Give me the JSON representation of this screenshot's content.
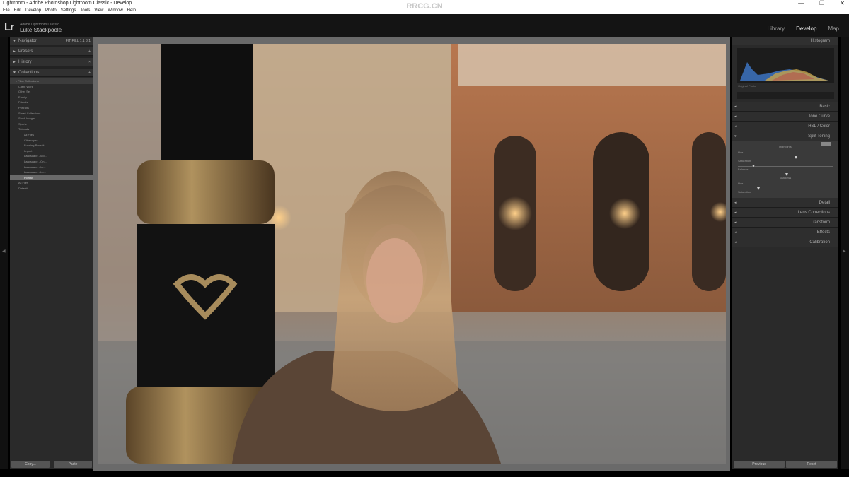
{
  "window": {
    "title": "Lightroom - Adobe Photoshop Lightroom Classic - Develop",
    "controls": [
      "—",
      "❐",
      "✕"
    ]
  },
  "watermark": "RRCG.CN",
  "menu": [
    "File",
    "Edit",
    "Develop",
    "Photo",
    "Settings",
    "Tools",
    "View",
    "Window",
    "Help"
  ],
  "identity": {
    "logo": "Lr",
    "sub": "Adobe Lightroom Classic",
    "name": "Luke Stackpoole"
  },
  "modules": [
    "Library",
    "Develop",
    "Map"
  ],
  "left_panel": {
    "navigator": {
      "label": "Navigator",
      "zoom": "FIT FILL 1:1 3:1"
    },
    "presets": "Presets",
    "history": "History",
    "collections": "Collections",
    "filter": "Filter Collections",
    "tree": [
      {
        "label": "Client Work",
        "count": "",
        "indent": 1
      },
      {
        "label": "Other Set",
        "count": "",
        "indent": 1
      },
      {
        "label": "Family",
        "count": "",
        "indent": 1
      },
      {
        "label": "Friends",
        "count": "",
        "indent": 1
      },
      {
        "label": "Portraits",
        "count": "",
        "indent": 1
      },
      {
        "label": "Smart Collections",
        "count": "",
        "indent": 1
      },
      {
        "label": "Stock Images",
        "count": "",
        "indent": 1
      },
      {
        "label": "Sports",
        "count": "",
        "indent": 1
      },
      {
        "label": "Tutorials",
        "count": "",
        "indent": 1
      },
      {
        "label": "All Files",
        "count": "",
        "indent": 2
      },
      {
        "label": "Cityscapes",
        "count": "",
        "indent": 2
      },
      {
        "label": "Evening Portrait",
        "count": "",
        "indent": 2
      },
      {
        "label": "Import",
        "count": "",
        "indent": 2
      },
      {
        "label": "Landscape - Mo...",
        "count": "",
        "indent": 2
      },
      {
        "label": "Landscape - On...",
        "count": "",
        "indent": 2
      },
      {
        "label": "Landscape - Ur...",
        "count": "",
        "indent": 2
      },
      {
        "label": "Landscape - Lo...",
        "count": "",
        "indent": 2
      },
      {
        "label": "Portrait",
        "count": "",
        "indent": 2,
        "selected": true
      },
      {
        "label": "All Files",
        "count": "",
        "indent": 1
      },
      {
        "label": "Default",
        "count": "",
        "indent": 1
      }
    ],
    "buttons": {
      "import": "Copy...",
      "export": "Paste"
    }
  },
  "right_panel": {
    "histogram": "Histogram",
    "hist_info": "Original Photo",
    "sections": [
      "Basic",
      "Tone Curve",
      "HSL / Color",
      "Split Toning"
    ],
    "split_toning": {
      "highlights": "Highlights",
      "hue": "Hue",
      "saturation": "Saturation",
      "balance": "Balance",
      "shadows": "Shadows",
      "s_hue": "Hue",
      "s_saturation": "Saturation"
    },
    "sections_after": [
      "Detail",
      "Lens Corrections",
      "Transform",
      "Effects",
      "Calibration"
    ],
    "buttons": {
      "previous": "Previous",
      "reset": "Reset"
    }
  },
  "colors": {
    "panel": "#2a2a2a",
    "background": "#000000",
    "accent": "#eeeeee"
  }
}
